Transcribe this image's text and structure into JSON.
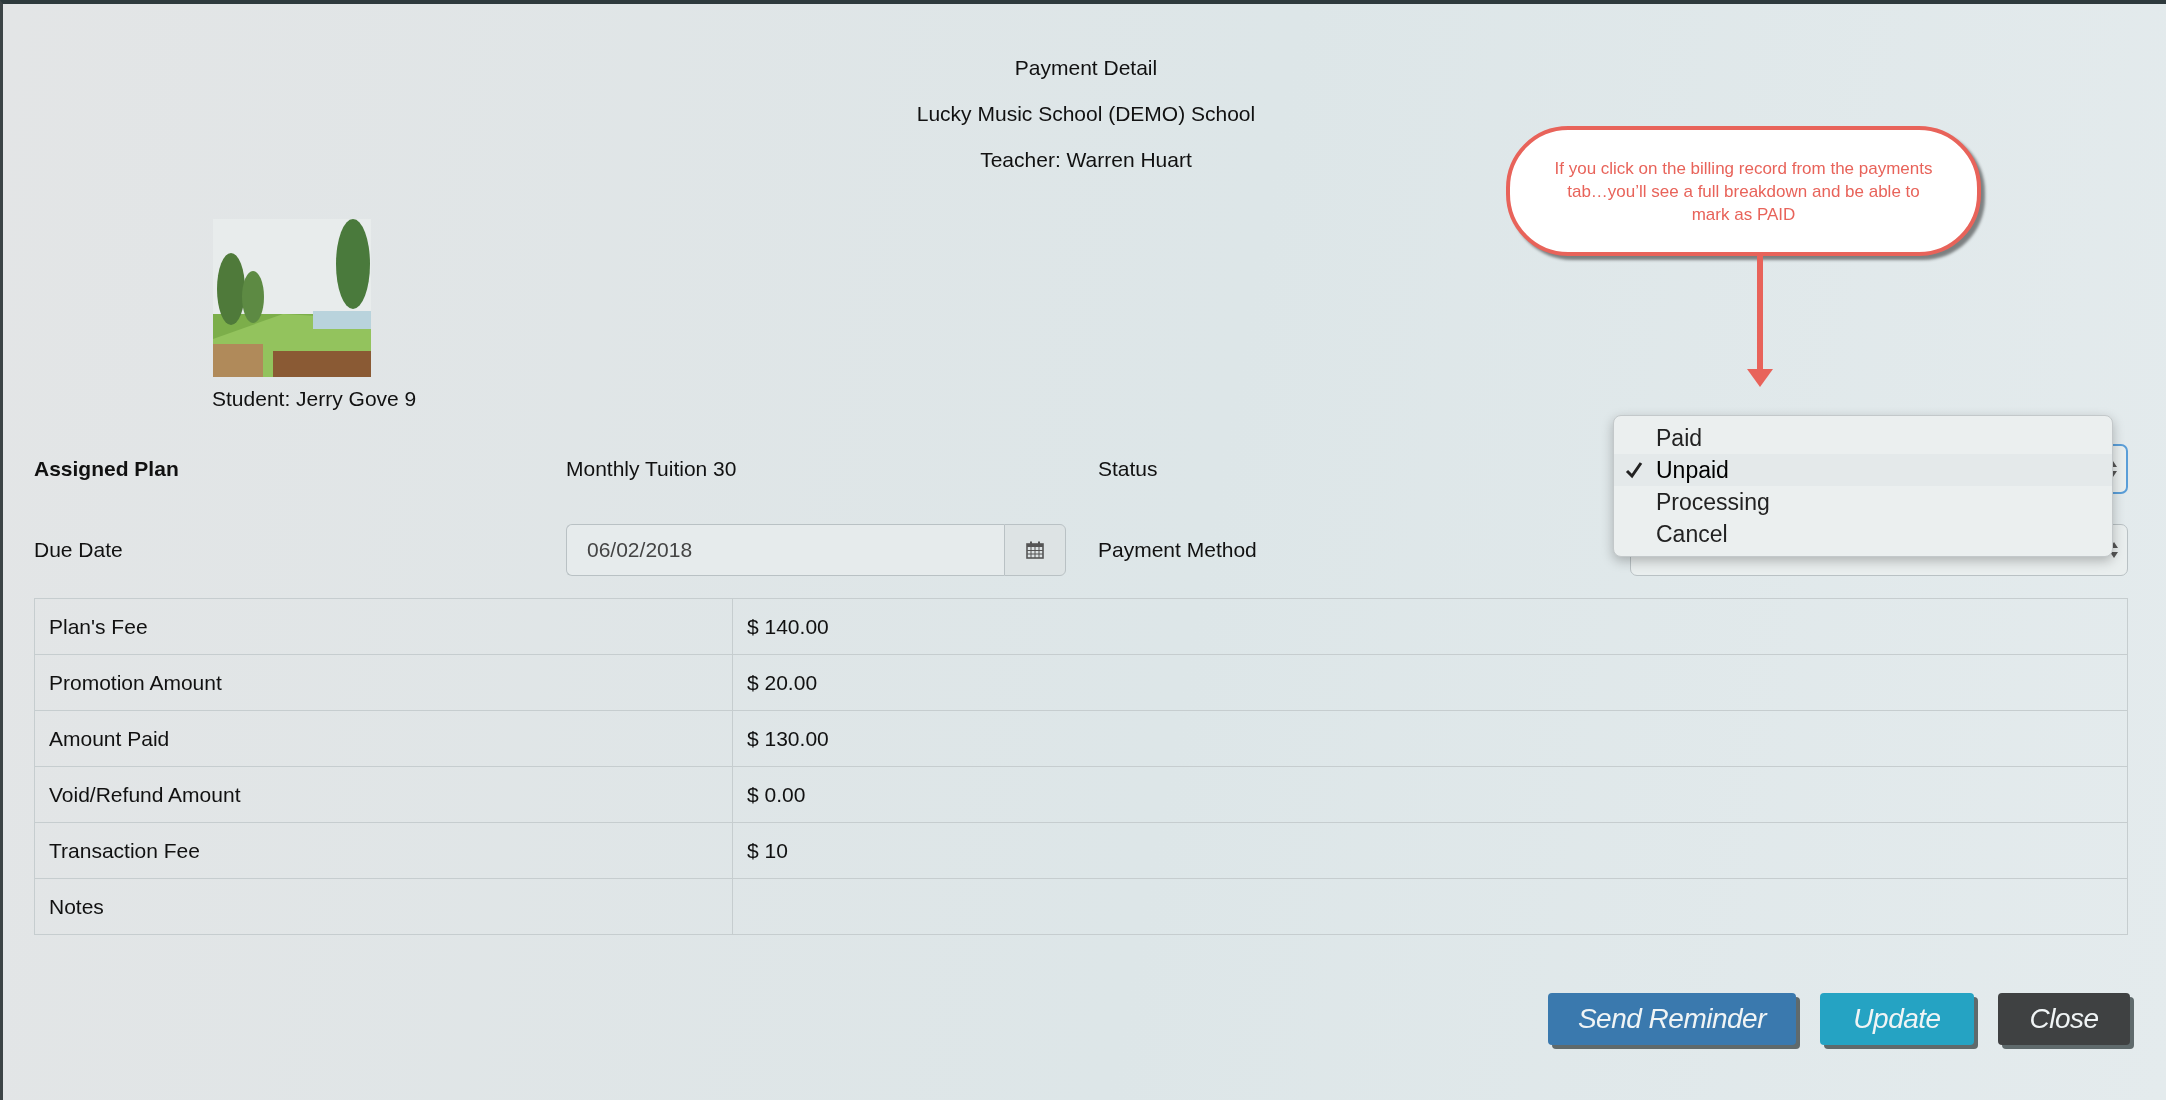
{
  "header": {
    "title": "Payment Detail",
    "school": "Lucky Music School (DEMO) School",
    "teacher": "Teacher: Warren Huart"
  },
  "student": {
    "name": "Student: Jerry Gove 9"
  },
  "form": {
    "assigned_plan_label": "Assigned Plan",
    "assigned_plan": "Monthly Tuition 30",
    "status_label": "Status",
    "due_date_label": "Due Date",
    "due_date": "06/02/2018",
    "payment_method_label": "Payment Method"
  },
  "status_menu": {
    "options": [
      {
        "label": "Paid",
        "selected": false
      },
      {
        "label": "Unpaid",
        "selected": true
      },
      {
        "label": "Processing",
        "selected": false
      },
      {
        "label": "Cancel",
        "selected": false
      }
    ]
  },
  "table": {
    "rows": [
      {
        "label": "Plan's Fee",
        "value": "$ 140.00"
      },
      {
        "label": "Promotion Amount",
        "value": "$ 20.00"
      },
      {
        "label": "Amount Paid",
        "value": "$ 130.00"
      },
      {
        "label": "Void/Refund Amount",
        "value": "$ 0.00"
      },
      {
        "label": "Transaction Fee",
        "value": "$ 10"
      },
      {
        "label": "Notes"
      }
    ]
  },
  "callout": {
    "text": "If you click on the billing record from the payments tab…you’ll see a full breakdown and be able to mark as PAID"
  },
  "buttons": [
    {
      "label": "Send Reminder",
      "kind": "primary"
    },
    {
      "label": "Update",
      "kind": "info"
    },
    {
      "label": "Close",
      "kind": "dark"
    }
  ]
}
